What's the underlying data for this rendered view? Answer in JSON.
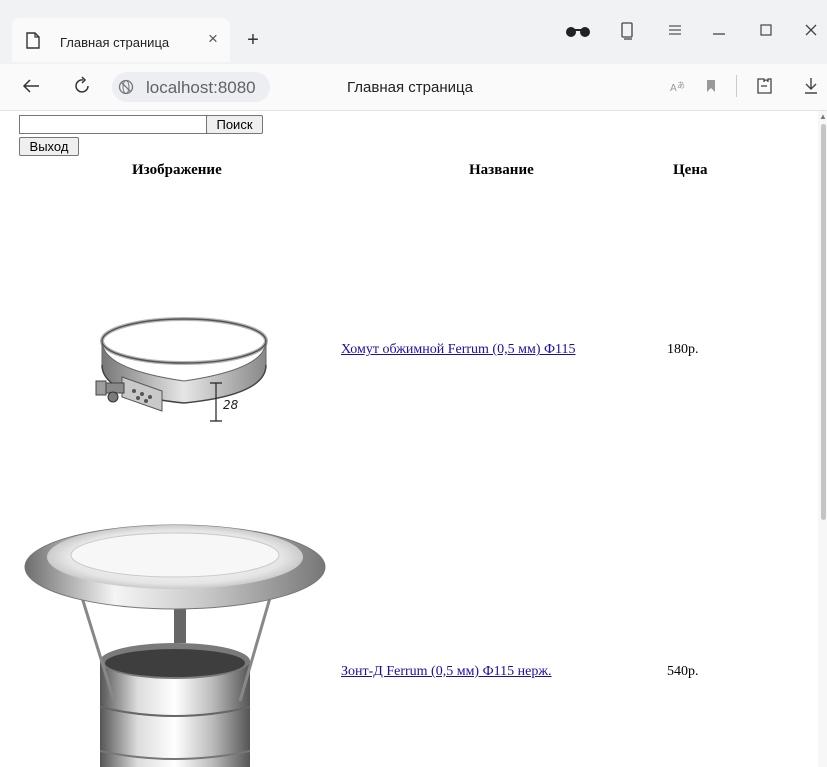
{
  "browser": {
    "tab_title": "Главная страница",
    "tab_close": "×",
    "new_tab": "+",
    "address": "localhost:8080",
    "page_title": "Главная страница"
  },
  "page": {
    "search": {
      "value": "",
      "button_label": "Поиск"
    },
    "logout_label": "Выход",
    "table": {
      "headers": [
        "Изображение",
        "Название",
        "Цена"
      ],
      "rows": [
        {
          "name": "Хомут обжимной Ferrum (0,5 мм) Ф115",
          "price": "180р.",
          "image": "clamp-image",
          "clamp_label": "28"
        },
        {
          "name": "Зонт-Д Ferrum (0,5 мм) Ф115 нерж.",
          "price": "540р.",
          "image": "chimney-cap-image"
        }
      ]
    }
  }
}
